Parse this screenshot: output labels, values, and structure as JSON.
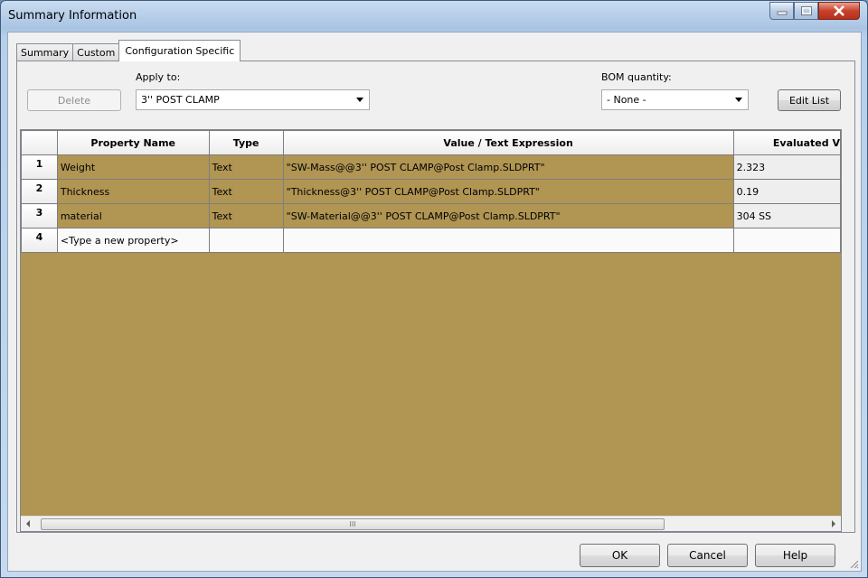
{
  "window": {
    "title": "Summary Information"
  },
  "tabs": [
    {
      "label": "Summary"
    },
    {
      "label": "Custom"
    },
    {
      "label": "Configuration Specific"
    }
  ],
  "toolbar": {
    "delete_label": "Delete",
    "apply_to_label": "Apply to:",
    "apply_to_value": "3'' POST CLAMP",
    "bom_label": "BOM quantity:",
    "bom_value": "- None -",
    "edit_list_label": "Edit List"
  },
  "table": {
    "columns": [
      "",
      "Property Name",
      "Type",
      "Value / Text Expression",
      "Evaluated V"
    ],
    "rows": [
      {
        "num": "1",
        "name": "Weight",
        "type": "Text",
        "value": "\"SW-Mass@@3'' POST CLAMP@Post Clamp.SLDPRT\"",
        "evaluated": "2.323"
      },
      {
        "num": "2",
        "name": "Thickness",
        "type": "Text",
        "value": "\"Thickness@3'' POST CLAMP@Post Clamp.SLDPRT\"",
        "evaluated": "0.19"
      },
      {
        "num": "3",
        "name": "material",
        "type": "Text",
        "value": "\"SW-Material@@3'' POST CLAMP@Post Clamp.SLDPRT\"",
        "evaluated": "304 SS"
      },
      {
        "num": "4",
        "name": "<Type a new property>",
        "type": "",
        "value": "",
        "evaluated": ""
      }
    ],
    "scroll_thumb_glyph": "III"
  },
  "footer": {
    "ok_label": "OK",
    "cancel_label": "Cancel",
    "help_label": "Help"
  },
  "colors": {
    "fill": "#b09553"
  }
}
